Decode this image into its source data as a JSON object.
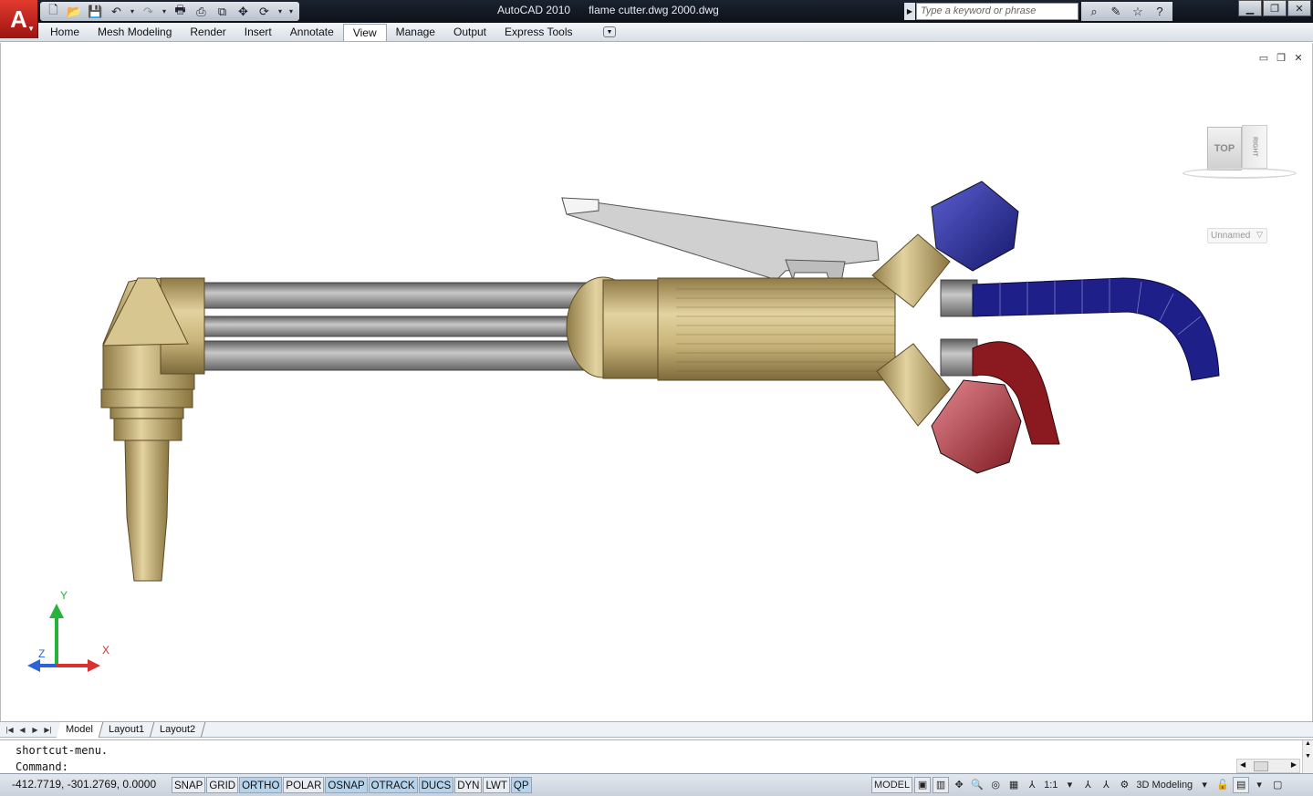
{
  "app": {
    "logo_letter": "A",
    "product": "AutoCAD 2010",
    "document": "flame cutter.dwg 2000.dwg"
  },
  "qat": {
    "icons": [
      "new-icon",
      "open-icon",
      "save-icon",
      "undo-icon",
      "redo-icon",
      "plot-icon",
      "plot-preview-icon",
      "publish-icon",
      "pan-icon",
      "workspace-icon"
    ]
  },
  "search": {
    "placeholder": "Type a keyword or phrase"
  },
  "menu": {
    "items": [
      "Home",
      "Mesh Modeling",
      "Render",
      "Insert",
      "Annotate",
      "View",
      "Manage",
      "Output",
      "Express Tools"
    ],
    "active": "View"
  },
  "viewport": {
    "viewcube_top": "TOP",
    "viewcube_right": "RIGHT",
    "ucs_label": "Unnamed",
    "axis_x": "X",
    "axis_y": "Y",
    "axis_z": "Z",
    "colors": {
      "brass": "#c9b47a",
      "steel": "#9a9a9a",
      "blue_knob": "#2c2f9a",
      "red_knob": "#b8343f",
      "blue_hose": "#1f1f8a",
      "red_hose": "#8a1a1f"
    }
  },
  "layout_tabs": [
    "Model",
    "Layout1",
    "Layout2"
  ],
  "command": {
    "lines": [
      "shortcut-menu.",
      "Command:"
    ]
  },
  "status": {
    "coordinates": "-412.7719, -301.2769, 0.0000",
    "toggles": [
      {
        "label": "SNAP",
        "on": false
      },
      {
        "label": "GRID",
        "on": false
      },
      {
        "label": "ORTHO",
        "on": true
      },
      {
        "label": "POLAR",
        "on": false
      },
      {
        "label": "OSNAP",
        "on": true
      },
      {
        "label": "OTRACK",
        "on": true
      },
      {
        "label": "DUCS",
        "on": true
      },
      {
        "label": "DYN",
        "on": false
      },
      {
        "label": "LWT",
        "on": false
      },
      {
        "label": "QP",
        "on": true
      }
    ],
    "model_label": "MODEL",
    "annotation_scale": "1:1",
    "workspace": "3D Modeling"
  }
}
